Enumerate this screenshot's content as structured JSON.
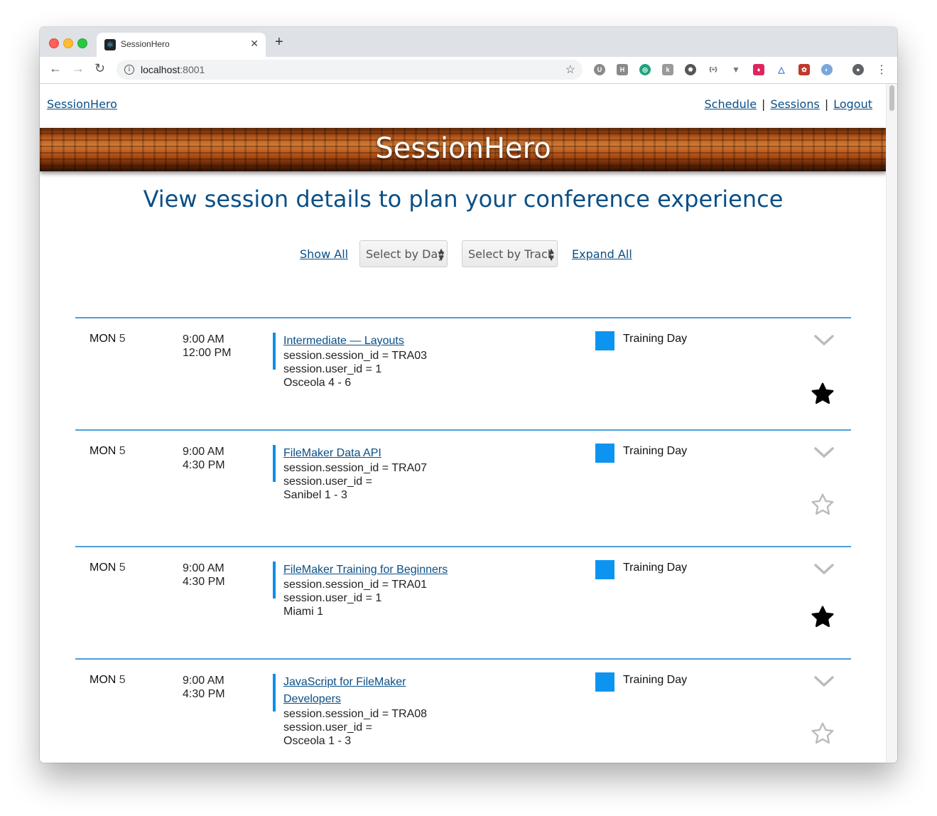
{
  "browser": {
    "tab_title": "SessionHero",
    "url_host": "localhost",
    "url_port": ":8001"
  },
  "nav": {
    "brand": "SessionHero",
    "links": [
      "Schedule",
      "Sessions",
      "Logout"
    ],
    "separator": "|"
  },
  "banner": {
    "title": "SessionHero"
  },
  "headline": "View session details to plan your conference experience",
  "filters": {
    "show_all": "Show All",
    "day_select": "Select by Day",
    "track_select": "Select by Track",
    "expand_all": "Expand All"
  },
  "sessions": [
    {
      "day": "MON",
      "date": "5",
      "start": "9:00 AM",
      "end": "12:00 PM",
      "title": "Intermediate — Layouts",
      "session_id_line": "session.session_id = TRA03",
      "user_id_line": "session.user_id = 1",
      "room": "Osceola 4 - 6",
      "track": "Training Day",
      "starred": true
    },
    {
      "day": "MON",
      "date": "5",
      "start": "9:00 AM",
      "end": "4:30 PM",
      "title": "FileMaker Data API",
      "session_id_line": "session.session_id = TRA07",
      "user_id_line": "session.user_id =",
      "room": "Sanibel 1 - 3",
      "track": "Training Day",
      "starred": false
    },
    {
      "day": "MON",
      "date": "5",
      "start": "9:00 AM",
      "end": "4:30 PM",
      "title": "FileMaker Training for Beginners",
      "session_id_line": "session.session_id = TRA01",
      "user_id_line": "session.user_id = 1",
      "room": "Miami 1",
      "track": "Training Day",
      "starred": true
    },
    {
      "day": "MON",
      "date": "5",
      "start": "9:00 AM",
      "end": "4:30 PM",
      "title": "JavaScript for FileMaker Developers",
      "session_id_line": "session.session_id = TRA08",
      "user_id_line": "session.user_id =",
      "room": "Osceola 1 - 3",
      "track": "Training Day",
      "starred": false
    }
  ],
  "colors": {
    "link": "#0a4f86",
    "divider": "#4c9fdc",
    "track_swatch": "#0d94f0",
    "star_filled": "#000000",
    "star_empty": "#bbbbbb",
    "chevron": "#bbbbbb"
  },
  "icons": [
    "react-favicon",
    "info-icon",
    "bookmark-star-icon",
    "chevron-down-icon",
    "star-icon"
  ]
}
